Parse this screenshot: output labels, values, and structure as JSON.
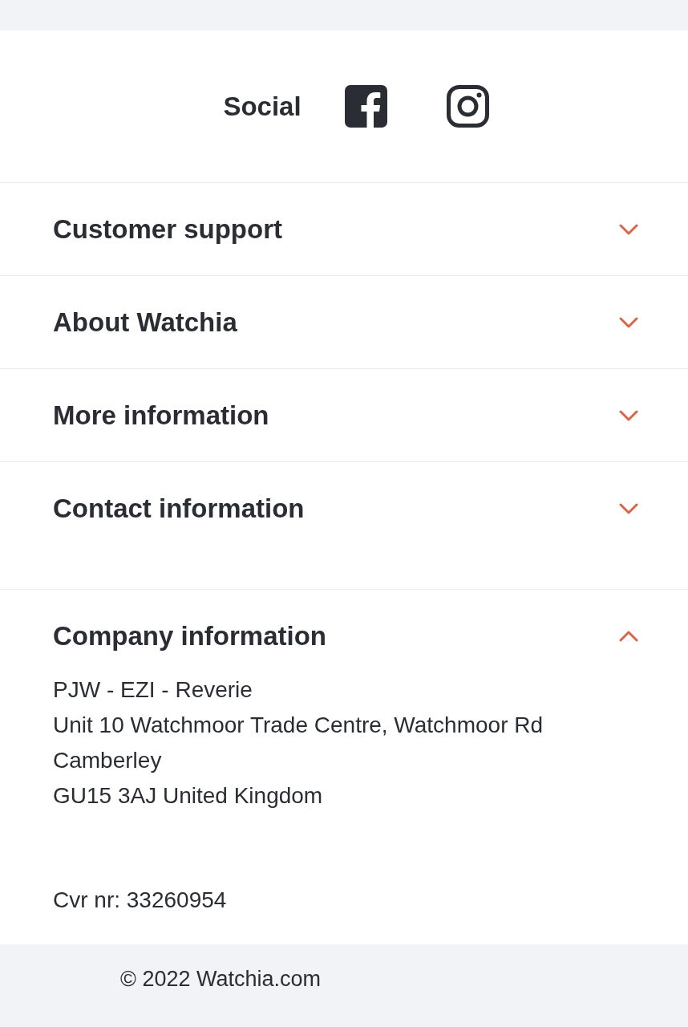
{
  "social": {
    "label": "Social",
    "links": [
      {
        "kind": "facebook"
      },
      {
        "kind": "instagram"
      }
    ]
  },
  "sections": [
    {
      "title": "Customer support",
      "expanded": false
    },
    {
      "title": "About Watchia",
      "expanded": false
    },
    {
      "title": "More information",
      "expanded": false
    },
    {
      "title": "Contact information",
      "expanded": false
    },
    {
      "title": "Company information",
      "expanded": true,
      "lines": [
        "PJW - EZI - Reverie",
        "Unit 10 Watchmoor Trade Centre, Watchmoor Rd",
        "Camberley",
        "GU15 3AJ United Kingdom"
      ],
      "registration": "Cvr nr: 33260954"
    }
  ],
  "copyright": "© 2022 Watchia.com"
}
